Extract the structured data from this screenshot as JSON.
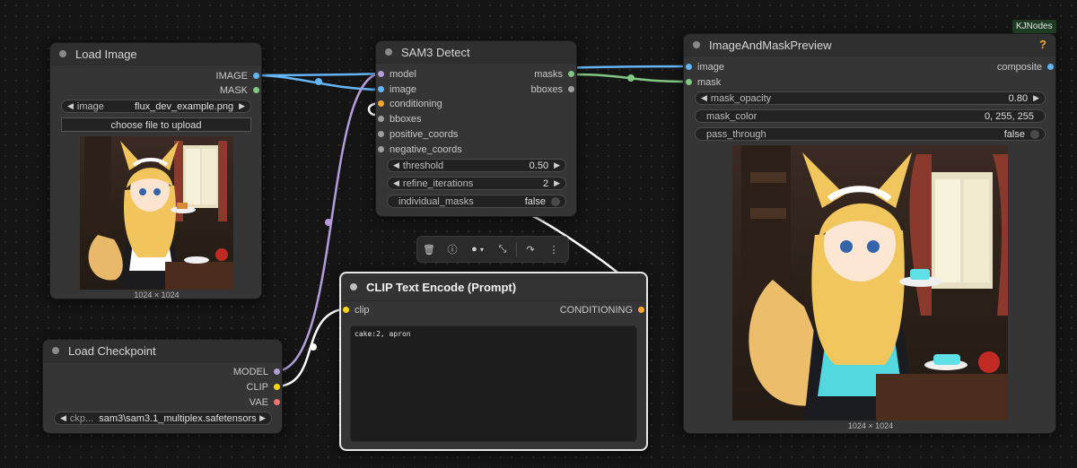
{
  "badge": "KJNodes",
  "colors": {
    "image": "#64b5f6",
    "mask": "#81c784",
    "model": "#b39ddb",
    "clip": "#ffd500",
    "vae": "#ff6e6e",
    "conditioning": "#ffa931",
    "bboxes": "#9e9e9e",
    "help": "#f0a830"
  },
  "load_image": {
    "title": "Load Image",
    "outputs": [
      "IMAGE",
      "MASK"
    ],
    "image_widget": {
      "label": "image",
      "value": "flux_dev_example.png"
    },
    "upload_button": "choose file to upload",
    "size_caption": "1024 × 1024"
  },
  "sam3": {
    "title": "SAM3 Detect",
    "inputs": [
      "model",
      "image",
      "conditioning",
      "bboxes",
      "positive_coords",
      "negative_coords"
    ],
    "outputs": [
      "masks",
      "bboxes"
    ],
    "widgets": [
      {
        "label": "threshold",
        "value": "0.50"
      },
      {
        "label": "refine_iterations",
        "value": "2"
      },
      {
        "label": "individual_masks",
        "value": "false"
      }
    ]
  },
  "preview": {
    "title": "ImageAndMaskPreview",
    "help": "?",
    "inputs": [
      "image",
      "mask"
    ],
    "outputs": [
      "composite"
    ],
    "widgets": [
      {
        "label": "mask_opacity",
        "value": "0.80"
      },
      {
        "label": "mask_color",
        "value": "0, 255, 255"
      },
      {
        "label": "pass_through",
        "value": "false"
      }
    ],
    "size_caption": "1024 × 1024"
  },
  "clip_encode": {
    "title": "CLIP Text Encode (Prompt)",
    "inputs": [
      "clip"
    ],
    "outputs": [
      "CONDITIONING"
    ],
    "text": "cake:2, apron"
  },
  "checkpoint": {
    "title": "Load Checkpoint",
    "outputs": [
      "MODEL",
      "CLIP",
      "VAE"
    ],
    "ckpt_widget": {
      "label": "ckp...",
      "value": "sam3\\sam3.1_multiplex.safetensors"
    }
  },
  "toolbar": {
    "icons": [
      "trash-icon",
      "info-icon",
      "color-icon",
      "chevron-down-icon",
      "collapse-icon",
      "bypass-icon",
      "more-icon"
    ]
  }
}
